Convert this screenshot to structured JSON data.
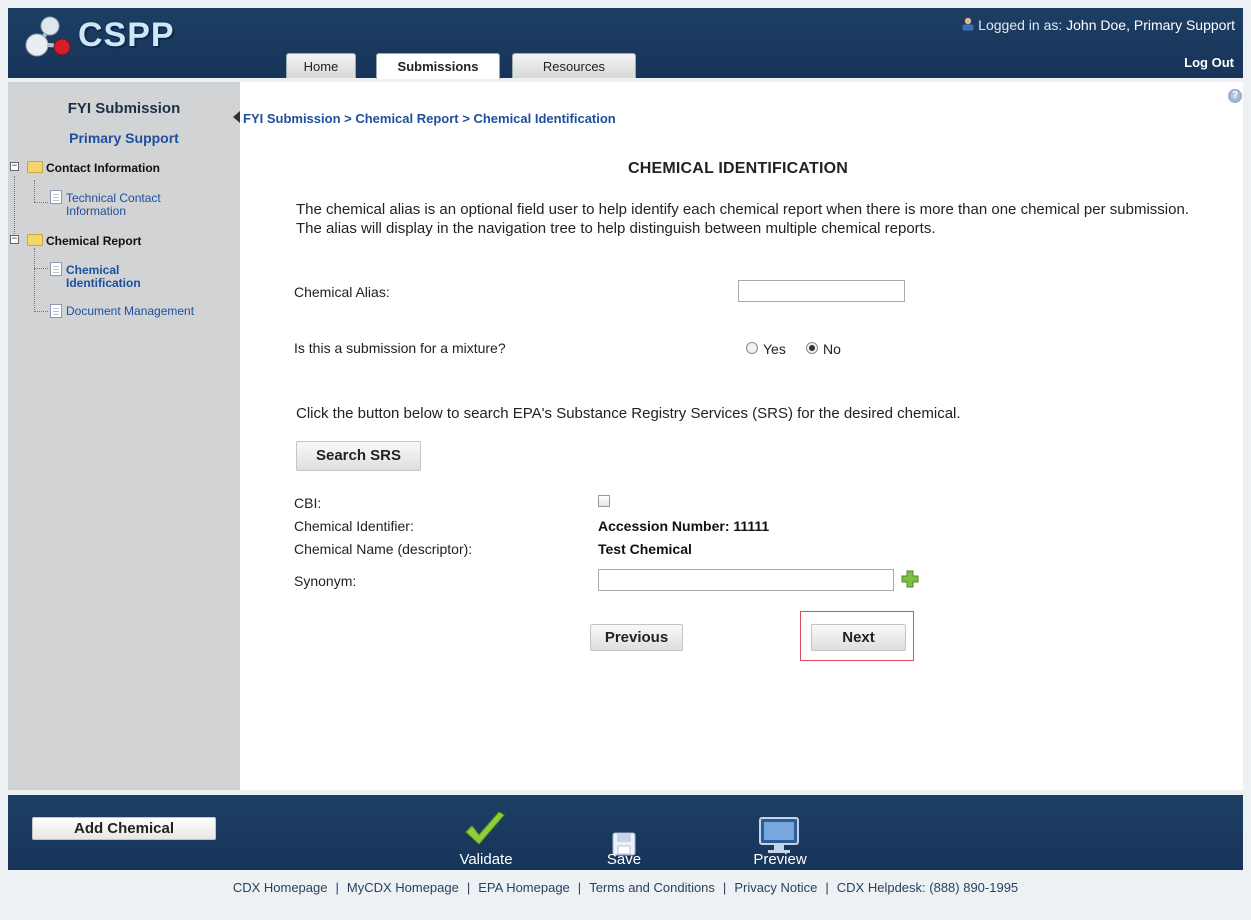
{
  "header": {
    "logo_text": "CSPP",
    "logged_in_label": "Logged in as:",
    "user_name": "John Doe, Primary Support",
    "logout_label": "Log Out",
    "tabs": [
      {
        "label": "Home"
      },
      {
        "label": "Submissions"
      },
      {
        "label": "Resources"
      }
    ]
  },
  "sidebar": {
    "title": "FYI Submission",
    "subtitle": "Primary Support",
    "tree": {
      "contact": {
        "label": "Contact Information",
        "child_line1": "Technical Contact",
        "child_line2": "Information"
      },
      "chemical": {
        "label": "Chemical Report",
        "child1_line1": "Chemical",
        "child1_line2": "Identification",
        "child2": "Document Management"
      }
    }
  },
  "main": {
    "breadcrumb": "FYI Submission > Chemical Report > Chemical Identification",
    "title": "CHEMICAL IDENTIFICATION",
    "intro": "The chemical alias is an optional field user to help identify each chemical report when there is more than one chemical per submission. The alias will display in the navigation tree to help distinguish between multiple chemical reports.",
    "alias_label": "Chemical Alias:",
    "alias_value": "",
    "mixture_label": "Is this a submission for a mixture?",
    "mixture_yes": "Yes",
    "mixture_no": "No",
    "srs_instruction": "Click the button below to search EPA's Substance Registry Services (SRS) for the desired chemical.",
    "search_srs_label": "Search SRS",
    "cbi_label": "CBI:",
    "identifier_label": "Chemical Identifier:",
    "identifier_value": "Accession Number: 11111",
    "name_label": "Chemical Name (descriptor):",
    "name_value": "Test Chemical",
    "synonym_label": "Synonym:",
    "synonym_value": "",
    "previous_label": "Previous",
    "next_label": "Next"
  },
  "footer": {
    "add_chemical_label": "Add Chemical",
    "validate_label": "Validate",
    "save_label": "Save",
    "preview_label": "Preview",
    "links": [
      "CDX Homepage",
      "MyCDX Homepage",
      "EPA Homepage",
      "Terms and Conditions",
      "Privacy Notice",
      "CDX Helpdesk: (888) 890-1995"
    ]
  }
}
